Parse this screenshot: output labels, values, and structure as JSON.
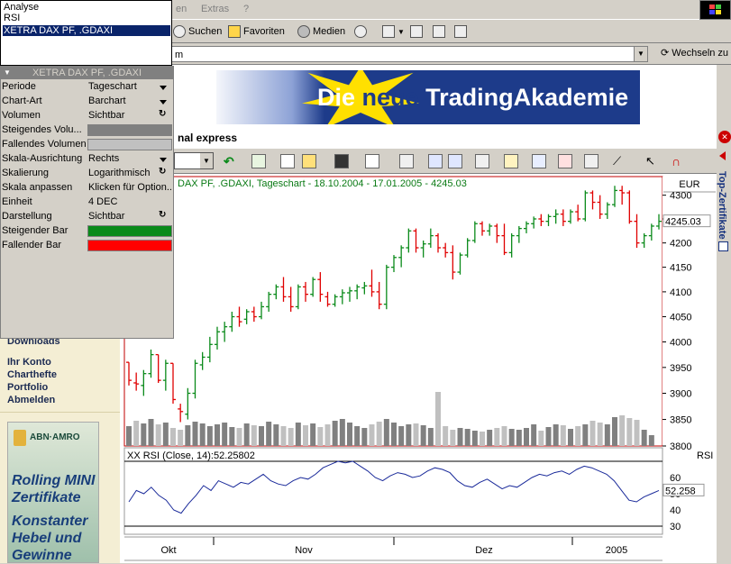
{
  "menu": {
    "extras": "Extras",
    "help": "?",
    "view_partial": "en"
  },
  "toolbar": {
    "search": "Suchen",
    "favorites": "Favoriten",
    "media": "Medien"
  },
  "addressbar": {
    "value": "m",
    "go_label": "Wechseln zu"
  },
  "banner": {
    "text_die": "Die",
    "text_neue": "neue",
    "text_rest": "TradingAkademie"
  },
  "chart_window": {
    "title": "nal express",
    "sidebar_tab": "Top-Zertifikate"
  },
  "left_links": [
    "Downloads",
    "Ihr Konto",
    "Charthefte",
    "Portfolio",
    "Abmelden"
  ],
  "ad": {
    "brand": "ABN·AMRO",
    "lines": [
      "Rolling MINI",
      "Zertifikate",
      "Konstanter",
      "Hebel und",
      "Gewinne"
    ]
  },
  "dropdown": {
    "items": [
      "Analyse",
      "RSI",
      "XETRA DAX PF, .GDAXI"
    ],
    "selected": 2
  },
  "properties": {
    "header": "XETRA DAX PF, .GDAXI",
    "rows": [
      {
        "label": "Periode",
        "value": "Tageschart",
        "ctrl": "arrow"
      },
      {
        "label": "Chart-Art",
        "value": "Barchart",
        "ctrl": "arrow"
      },
      {
        "label": "Volumen",
        "value": "Sichtbar",
        "ctrl": "rotate"
      },
      {
        "label": "Steigendes Volu...",
        "value": "",
        "ctrl": "swatch",
        "color": "#808080"
      },
      {
        "label": "Fallendes Volumen",
        "value": "",
        "ctrl": "swatch",
        "color": "#c0c0c0"
      },
      {
        "label": "Skala-Ausrichtung",
        "value": "Rechts",
        "ctrl": "arrow"
      },
      {
        "label": "Skalierung",
        "value": "Logarithmisch",
        "ctrl": "rotate"
      },
      {
        "label": "Skala anpassen",
        "value": "Klicken für Option...",
        "ctrl": ""
      },
      {
        "label": "Einheit",
        "value": "4 DEC",
        "ctrl": ""
      },
      {
        "label": "Darstellung",
        "value": "Sichtbar",
        "ctrl": "rotate"
      },
      {
        "label": "Steigender Bar",
        "value": "",
        "ctrl": "swatch",
        "color": "#0a8a1a"
      },
      {
        "label": "Fallender Bar",
        "value": "",
        "ctrl": "swatch",
        "color": "#ff0000"
      }
    ]
  },
  "chart_data": {
    "type": "bar",
    "title": "DAX PF, .GDAXI, Tageschart - 18.10.2004 - 17.01.2005 - 4245.03",
    "currency": "EUR",
    "price_ticks": [
      4300,
      4250,
      4200,
      4150,
      4100,
      4050,
      4000,
      3950,
      3900,
      3850,
      3800
    ],
    "last_price": "4245.03",
    "ylim": [
      3800,
      4330
    ],
    "x_labels": [
      "Okt",
      "Nov",
      "Dez",
      "2005"
    ],
    "colors": {
      "up": "#0a8a1a",
      "down": "#e00000"
    },
    "ohlc": [
      [
        3960,
        3960,
        3915,
        3925
      ],
      [
        3920,
        3940,
        3905,
        3918
      ],
      [
        3915,
        3945,
        3895,
        3938
      ],
      [
        3938,
        3985,
        3930,
        3975
      ],
      [
        3975,
        3975,
        3920,
        3925
      ],
      [
        3925,
        3965,
        3905,
        3958
      ],
      [
        3958,
        3958,
        3880,
        3888
      ],
      [
        3870,
        3880,
        3845,
        3865
      ],
      [
        3860,
        3910,
        3850,
        3900
      ],
      [
        3900,
        3965,
        3890,
        3958
      ],
      [
        3955,
        3980,
        3945,
        3970
      ],
      [
        3970,
        4010,
        3960,
        3995
      ],
      [
        3995,
        4030,
        3985,
        4020
      ],
      [
        4020,
        4040,
        4000,
        4030
      ],
      [
        4030,
        4060,
        4020,
        4050
      ],
      [
        4050,
        4070,
        4030,
        4040
      ],
      [
        4045,
        4065,
        4035,
        4060
      ],
      [
        4060,
        4070,
        4040,
        4050
      ],
      [
        4050,
        4080,
        4045,
        4070
      ],
      [
        4070,
        4100,
        4060,
        4095
      ],
      [
        4095,
        4115,
        4085,
        4110
      ],
      [
        4110,
        4130,
        4080,
        4090
      ],
      [
        4090,
        4110,
        4060,
        4070
      ],
      [
        4070,
        4115,
        4065,
        4110
      ],
      [
        4110,
        4120,
        4080,
        4095
      ],
      [
        4095,
        4130,
        4090,
        4125
      ],
      [
        4125,
        4140,
        4080,
        4095
      ],
      [
        4090,
        4100,
        4070,
        4075
      ],
      [
        4075,
        4095,
        4070,
        4090
      ],
      [
        4090,
        4105,
        4075,
        4098
      ],
      [
        4098,
        4110,
        4080,
        4102
      ],
      [
        4102,
        4115,
        4085,
        4110
      ],
      [
        4108,
        4120,
        4095,
        4112
      ],
      [
        4112,
        4145,
        4090,
        4100
      ],
      [
        4100,
        4120,
        4065,
        4075
      ],
      [
        4075,
        4155,
        4065,
        4150
      ],
      [
        4150,
        4175,
        4140,
        4170
      ],
      [
        4170,
        4195,
        4150,
        4190
      ],
      [
        4190,
        4230,
        4180,
        4225
      ],
      [
        4225,
        4230,
        4180,
        4190
      ],
      [
        4190,
        4205,
        4170,
        4198
      ],
      [
        4198,
        4230,
        4190,
        4215
      ],
      [
        4215,
        4220,
        4180,
        4190
      ],
      [
        4190,
        4200,
        4170,
        4180
      ],
      [
        4180,
        4195,
        4125,
        4140
      ],
      [
        4140,
        4180,
        4135,
        4175
      ],
      [
        4175,
        4210,
        4170,
        4205
      ],
      [
        4205,
        4245,
        4200,
        4240
      ],
      [
        4240,
        4245,
        4215,
        4225
      ],
      [
        4225,
        4240,
        4215,
        4235
      ],
      [
        4235,
        4240,
        4200,
        4215
      ],
      [
        4215,
        4240,
        4175,
        4180
      ],
      [
        4180,
        4220,
        4170,
        4215
      ],
      [
        4215,
        4235,
        4200,
        4230
      ],
      [
        4230,
        4245,
        4220,
        4240
      ],
      [
        4240,
        4255,
        4230,
        4250
      ],
      [
        4250,
        4260,
        4235,
        4245
      ],
      [
        4245,
        4260,
        4235,
        4255
      ],
      [
        4255,
        4270,
        4240,
        4260
      ],
      [
        4260,
        4270,
        4235,
        4245
      ],
      [
        4245,
        4270,
        4240,
        4265
      ],
      [
        4265,
        4280,
        4245,
        4250
      ],
      [
        4250,
        4310,
        4245,
        4305
      ],
      [
        4305,
        4310,
        4270,
        4285
      ],
      [
        4285,
        4300,
        4250,
        4260
      ],
      [
        4260,
        4285,
        4250,
        4280
      ],
      [
        4280,
        4320,
        4275,
        4310
      ],
      [
        4310,
        4320,
        4280,
        4305
      ],
      [
        4305,
        4310,
        4240,
        4245
      ],
      [
        4245,
        4260,
        4190,
        4200
      ],
      [
        4200,
        4220,
        4190,
        4215
      ],
      [
        4215,
        4240,
        4205,
        4235
      ],
      [
        4235,
        4260,
        4228,
        4245
      ]
    ],
    "volume": [
      22,
      28,
      25,
      30,
      24,
      26,
      20,
      18,
      23,
      27,
      25,
      22,
      24,
      26,
      21,
      20,
      25,
      23,
      22,
      27,
      24,
      22,
      20,
      26,
      23,
      25,
      21,
      24,
      28,
      30,
      26,
      22,
      20,
      24,
      27,
      30,
      26,
      22,
      24,
      25,
      23,
      20,
      60,
      22,
      18,
      20,
      19,
      17,
      16,
      18,
      20,
      22,
      19,
      18,
      20,
      24,
      17,
      21,
      24,
      23,
      19,
      22,
      24,
      28,
      26,
      24,
      32,
      34,
      31,
      29,
      18,
      12
    ],
    "volume_up": [
      1,
      0,
      1,
      1,
      0,
      1,
      0,
      0,
      1,
      1,
      1,
      1,
      1,
      1,
      1,
      0,
      1,
      0,
      1,
      1,
      1,
      0,
      0,
      1,
      0,
      1,
      0,
      0,
      1,
      1,
      1,
      1,
      1,
      0,
      0,
      1,
      1,
      1,
      1,
      0,
      1,
      1,
      0,
      0,
      0,
      1,
      1,
      1,
      0,
      1,
      0,
      0,
      1,
      1,
      1,
      1,
      0,
      1,
      1,
      0,
      1,
      0,
      1,
      0,
      0,
      1,
      1,
      0,
      0,
      0,
      1,
      1,
      1
    ],
    "rsi": {
      "label": "XX RSI (Close, 14):52.25802",
      "value_label": "52.258",
      "ticks": [
        60,
        50,
        40,
        30
      ],
      "ylim": [
        25,
        75
      ],
      "bands": [
        70,
        30
      ],
      "values": [
        45,
        52,
        50,
        54,
        49,
        46,
        40,
        38,
        44,
        49,
        55,
        52,
        58,
        56,
        54,
        57,
        56,
        59,
        62,
        58,
        56,
        55,
        58,
        60,
        59,
        62,
        66,
        68,
        70,
        69,
        70,
        67,
        64,
        60,
        58,
        61,
        63,
        62,
        60,
        61,
        64,
        66,
        65,
        63,
        58,
        55,
        54,
        57,
        59,
        56,
        53,
        55,
        54,
        57,
        60,
        62,
        61,
        63,
        64,
        62,
        65,
        67,
        66,
        64,
        62,
        58,
        52,
        46,
        45,
        48,
        50,
        52
      ]
    }
  }
}
